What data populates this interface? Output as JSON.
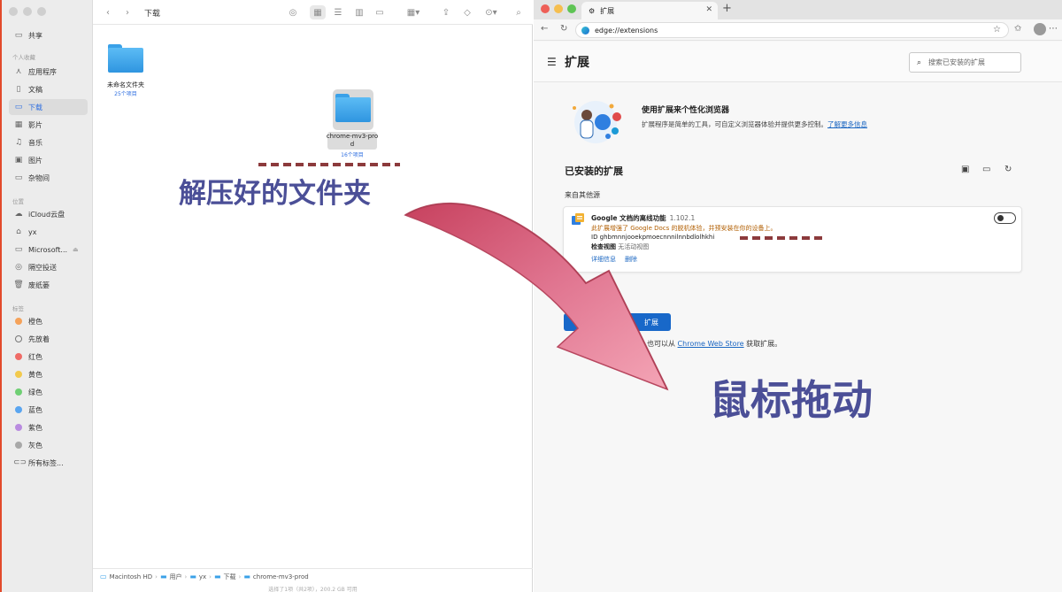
{
  "finder": {
    "toolbar_title": "下载",
    "sidebar": {
      "shared_label": "共享",
      "favorites_header": "个人收藏",
      "favorites": [
        {
          "label": "应用程序",
          "icon": "apps-icon"
        },
        {
          "label": "文稿",
          "icon": "document-icon"
        },
        {
          "label": "下载",
          "icon": "download-icon",
          "active": true
        },
        {
          "label": "影片",
          "icon": "film-icon"
        },
        {
          "label": "音乐",
          "icon": "music-icon"
        },
        {
          "label": "图片",
          "icon": "photo-icon"
        },
        {
          "label": "杂物间",
          "icon": "folder-icon"
        }
      ],
      "locations_header": "位置",
      "locations": [
        {
          "label": "iCloud云盘",
          "icon": "cloud-icon"
        },
        {
          "label": "yx",
          "icon": "home-icon"
        },
        {
          "label": "Microsoft...",
          "icon": "disk-icon"
        },
        {
          "label": "隔空投送",
          "icon": "airdrop-icon"
        },
        {
          "label": "废纸篓",
          "icon": "trash-icon"
        }
      ],
      "tags_header": "标签",
      "tags": [
        {
          "label": "橙色",
          "color": "#f5a25a"
        },
        {
          "label": "先放着",
          "color": ""
        },
        {
          "label": "红色",
          "color": "#ef6b66"
        },
        {
          "label": "黄色",
          "color": "#f2c94c"
        },
        {
          "label": "绿色",
          "color": "#6fcf74"
        },
        {
          "label": "蓝色",
          "color": "#5aa5f0"
        },
        {
          "label": "紫色",
          "color": "#b98be0"
        },
        {
          "label": "灰色",
          "color": "#a8a8a8"
        }
      ],
      "all_tags_label": "所有标签..."
    },
    "files": [
      {
        "name": "未命名文件夹",
        "meta": "25个项目"
      },
      {
        "name": "chrome-mv3-prod",
        "meta": "16个项目"
      }
    ],
    "path": [
      "Macintosh HD",
      "用户",
      "yx",
      "下载",
      "chrome-mv3-prod"
    ],
    "status": "选择了1项（共2项），200.2 GB 可用"
  },
  "edge": {
    "tab_title": "扩展",
    "url": "edge://extensions",
    "page_title": "扩展",
    "search_placeholder": "搜索已安装的扩展",
    "promo_title": "使用扩展来个性化浏览器",
    "promo_desc": "扩展程序是简单的工具，可自定义浏览器体验并提供更多控制。",
    "promo_link": "了解更多信息",
    "installed_title": "已安装的扩展",
    "from_other": "来自其他源",
    "extension": {
      "name": "Google 文档的离线功能",
      "version": "1.102.1",
      "warning": "此扩展增强了 Google Docs 的脱机体验，并预安装在你的设备上。",
      "id": "ID ghbmnnjooekpmoecnnnilnnbdlolhkhi",
      "view_label": "检查视图",
      "view_value": "无活动视图",
      "details_link": "详细信息",
      "remove_link": "删除",
      "enabled": false
    },
    "load_button": "扩展",
    "store_prefix": "也可以从",
    "store_link": "Chrome Web Store",
    "store_suffix": "获取扩展。"
  },
  "annotations": {
    "unzipped_folder": "解压好的文件夹",
    "mouse_drag": "鼠标拖动"
  },
  "colors": {
    "annotation_text": "#4b4f97",
    "arrow": "#d65c77",
    "dash": "#8c3a3c",
    "accent_blue": "#1868c9"
  }
}
